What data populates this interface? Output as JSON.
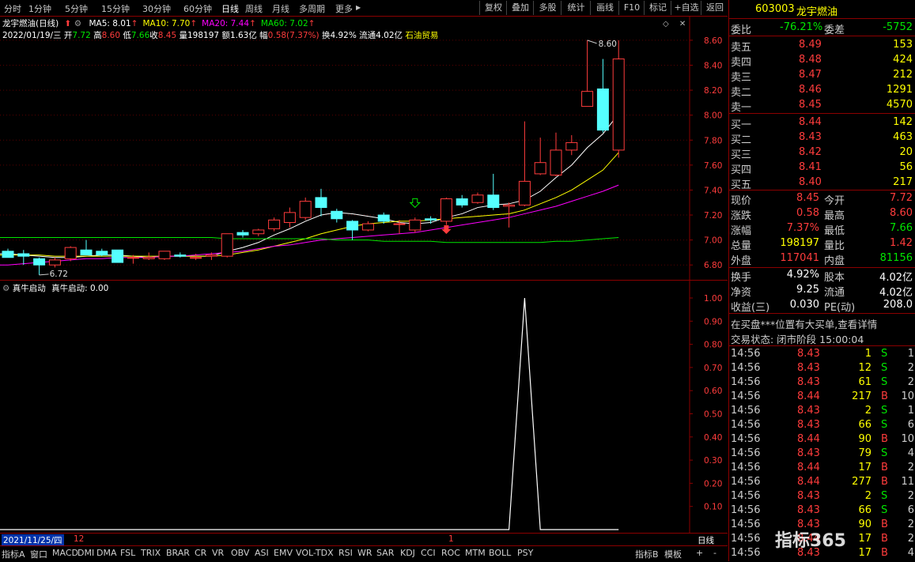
{
  "toolbar": {
    "timeframes": [
      "分时",
      "1分钟",
      "5分钟",
      "15分钟",
      "30分钟",
      "60分钟",
      "日线",
      "周线",
      "月线",
      "多周期",
      "更多"
    ],
    "active_timeframe": "日线",
    "more_arrow": "▶",
    "buttons": [
      "复权",
      "叠加",
      "多股",
      "统计",
      "画线",
      "F10",
      "标记",
      "+自选",
      "返回"
    ]
  },
  "main_chart": {
    "title": "龙宇燃油(日线)",
    "ma_labels": [
      {
        "text": "MA5: 8.01",
        "color": "#ffffff"
      },
      {
        "text": "MA10: 7.70",
        "color": "#ffff00"
      },
      {
        "text": "MA20: 7.44",
        "color": "#ff00ff"
      },
      {
        "text": "MA60: 7.02",
        "color": "#00e600"
      }
    ],
    "info": {
      "date": "2022/01/19/三",
      "open_label": "开",
      "open": "7.72",
      "high_label": "高",
      "high": "8.60",
      "low_label": "低",
      "low": "7.66",
      "close_label": "收",
      "close": "8.45",
      "vol_label": "量",
      "vol": "198197",
      "amt_label": "额",
      "amt": "1.63亿",
      "amp_label": "幅",
      "amp": "0.58(7.37%)",
      "turn_label": "换",
      "turn": "4.92%",
      "float_label": "流通",
      "float": "4.02亿",
      "concept": "石油贸易"
    },
    "y_ticks": [
      "8.60",
      "8.40",
      "8.20",
      "8.00",
      "7.80",
      "7.60",
      "7.40",
      "7.20",
      "7.00",
      "6.80"
    ],
    "max_label": "8.60",
    "min_label": "6.72"
  },
  "chart_data": [
    {
      "type": "candlestick",
      "title": "龙宇燃油(日线)",
      "ylim": [
        6.72,
        8.7
      ],
      "candles": [
        {
          "o": 6.91,
          "h": 6.93,
          "l": 6.86,
          "c": 6.86
        },
        {
          "o": 6.89,
          "h": 6.92,
          "l": 6.8,
          "c": 6.87
        },
        {
          "o": 6.85,
          "h": 6.86,
          "l": 6.72,
          "c": 6.8
        },
        {
          "o": 6.8,
          "h": 6.86,
          "l": 6.78,
          "c": 6.84
        },
        {
          "o": 6.85,
          "h": 6.95,
          "l": 6.83,
          "c": 6.94
        },
        {
          "o": 6.92,
          "h": 7.0,
          "l": 6.88,
          "c": 6.88
        },
        {
          "o": 6.91,
          "h": 6.93,
          "l": 6.87,
          "c": 6.88
        },
        {
          "o": 6.92,
          "h": 6.92,
          "l": 6.82,
          "c": 6.82
        },
        {
          "o": 6.86,
          "h": 6.88,
          "l": 6.81,
          "c": 6.86
        },
        {
          "o": 6.85,
          "h": 6.9,
          "l": 6.84,
          "c": 6.86
        },
        {
          "o": 6.85,
          "h": 6.91,
          "l": 6.84,
          "c": 6.91
        },
        {
          "o": 6.88,
          "h": 6.9,
          "l": 6.86,
          "c": 6.87
        },
        {
          "o": 6.86,
          "h": 6.89,
          "l": 6.84,
          "c": 6.86
        },
        {
          "o": 6.87,
          "h": 6.9,
          "l": 6.84,
          "c": 6.88
        },
        {
          "o": 6.87,
          "h": 7.05,
          "l": 6.86,
          "c": 7.05
        },
        {
          "o": 7.06,
          "h": 7.08,
          "l": 7.02,
          "c": 7.04
        },
        {
          "o": 7.05,
          "h": 7.09,
          "l": 7.03,
          "c": 7.08
        },
        {
          "o": 7.09,
          "h": 7.18,
          "l": 7.07,
          "c": 7.16
        },
        {
          "o": 7.14,
          "h": 7.26,
          "l": 7.1,
          "c": 7.22
        },
        {
          "o": 7.18,
          "h": 7.34,
          "l": 7.16,
          "c": 7.31
        },
        {
          "o": 7.34,
          "h": 7.41,
          "l": 7.19,
          "c": 7.26
        },
        {
          "o": 7.23,
          "h": 7.25,
          "l": 7.14,
          "c": 7.17
        },
        {
          "o": 7.15,
          "h": 7.16,
          "l": 7.0,
          "c": 7.08
        },
        {
          "o": 7.08,
          "h": 7.15,
          "l": 7.07,
          "c": 7.13
        },
        {
          "o": 7.2,
          "h": 7.22,
          "l": 7.13,
          "c": 7.15
        },
        {
          "o": 7.13,
          "h": 7.16,
          "l": 7.05,
          "c": 7.13
        },
        {
          "o": 7.08,
          "h": 7.18,
          "l": 7.06,
          "c": 7.16
        },
        {
          "o": 7.17,
          "h": 7.19,
          "l": 7.13,
          "c": 7.16
        },
        {
          "o": 7.15,
          "h": 7.34,
          "l": 7.12,
          "c": 7.33
        },
        {
          "o": 7.33,
          "h": 7.36,
          "l": 7.26,
          "c": 7.28
        },
        {
          "o": 7.3,
          "h": 7.38,
          "l": 7.29,
          "c": 7.36
        },
        {
          "o": 7.36,
          "h": 7.53,
          "l": 7.24,
          "c": 7.26
        },
        {
          "o": 7.27,
          "h": 7.3,
          "l": 7.1,
          "c": 7.28
        },
        {
          "o": 7.28,
          "h": 7.95,
          "l": 7.27,
          "c": 7.47
        },
        {
          "o": 7.53,
          "h": 7.82,
          "l": 7.52,
          "c": 7.62
        },
        {
          "o": 7.52,
          "h": 7.86,
          "l": 7.51,
          "c": 7.72
        },
        {
          "o": 7.72,
          "h": 7.84,
          "l": 7.68,
          "c": 7.78
        },
        {
          "o": 8.07,
          "h": 8.6,
          "l": 8.07,
          "c": 8.19
        },
        {
          "o": 8.21,
          "h": 8.45,
          "l": 7.86,
          "c": 7.88
        },
        {
          "o": 7.72,
          "h": 8.6,
          "l": 7.66,
          "c": 8.45
        }
      ],
      "series": [
        {
          "name": "MA5",
          "color": "#ffffff",
          "values": [
            6.89,
            6.88,
            6.87,
            6.86,
            6.86,
            6.87,
            6.88,
            6.88,
            6.87,
            6.86,
            6.87,
            6.87,
            6.87,
            6.87,
            6.91,
            6.94,
            6.98,
            7.04,
            7.09,
            7.15,
            7.2,
            7.22,
            7.21,
            7.19,
            7.17,
            7.14,
            7.13,
            7.14,
            7.18,
            7.21,
            7.26,
            7.28,
            7.29,
            7.32,
            7.39,
            7.5,
            7.6,
            7.74,
            7.85,
            8.01
          ]
        },
        {
          "name": "MA10",
          "color": "#ffff00",
          "values": [
            6.88,
            6.88,
            6.88,
            6.87,
            6.87,
            6.87,
            6.87,
            6.87,
            6.87,
            6.87,
            6.87,
            6.87,
            6.87,
            6.87,
            6.88,
            6.9,
            6.92,
            6.95,
            6.98,
            7.01,
            7.05,
            7.08,
            7.11,
            7.13,
            7.14,
            7.15,
            7.15,
            7.16,
            7.17,
            7.18,
            7.19,
            7.2,
            7.21,
            7.24,
            7.29,
            7.34,
            7.4,
            7.48,
            7.56,
            7.7
          ]
        },
        {
          "name": "MA20",
          "color": "#ff00ff",
          "values": [
            6.8,
            6.81,
            6.82,
            6.83,
            6.84,
            6.85,
            6.85,
            6.86,
            6.86,
            6.86,
            6.87,
            6.87,
            6.88,
            6.89,
            6.9,
            6.91,
            6.93,
            6.95,
            6.96,
            6.98,
            7.0,
            7.01,
            7.02,
            7.03,
            7.04,
            7.05,
            7.06,
            7.08,
            7.1,
            7.12,
            7.14,
            7.16,
            7.18,
            7.21,
            7.24,
            7.27,
            7.31,
            7.35,
            7.39,
            7.44
          ]
        },
        {
          "name": "MA60",
          "color": "#00e600",
          "values": [
            7.02,
            7.02,
            7.02,
            7.02,
            7.02,
            7.02,
            7.02,
            7.02,
            7.02,
            7.02,
            7.02,
            7.02,
            7.02,
            7.02,
            7.01,
            7.01,
            7.01,
            7.01,
            7.01,
            7.01,
            7.01,
            7.0,
            7.0,
            7.0,
            6.99,
            6.99,
            6.99,
            6.99,
            6.98,
            6.98,
            6.98,
            6.98,
            6.98,
            6.98,
            6.98,
            6.99,
            6.99,
            7.0,
            7.01,
            7.02
          ]
        }
      ]
    },
    {
      "type": "line",
      "title": "真牛启动",
      "ylim": [
        0,
        1.05
      ],
      "series": [
        {
          "name": "真牛启动",
          "values": [
            0,
            0,
            0,
            0,
            0,
            0,
            0,
            0,
            0,
            0,
            0,
            0,
            0,
            0,
            0,
            0,
            0,
            0,
            0,
            0,
            0,
            0,
            0,
            0,
            0,
            0,
            0,
            0,
            0,
            0,
            0,
            0,
            0,
            1,
            0,
            0,
            0,
            0,
            0,
            0
          ]
        }
      ]
    }
  ],
  "indicator_chart": {
    "name": "真牛启动",
    "value_label": "真牛启动: 0.00",
    "y_ticks": [
      "1.00",
      "0.90",
      "0.80",
      "0.70",
      "0.60",
      "0.50",
      "0.40",
      "0.30",
      "0.20",
      "0.10"
    ]
  },
  "x_axis": {
    "start_date": "2021/11/25/四",
    "tick1": "12",
    "tick2": "1",
    "period": "日线"
  },
  "bottom_tabs": [
    "指标A",
    "窗口",
    "MACD",
    "DMI",
    "DMA",
    "FSL",
    "TRIX",
    "BRAR",
    "CR",
    "VR",
    "OBV",
    "ASI",
    "EMV",
    "VOL-TDX",
    "RSI",
    "WR",
    "SAR",
    "KDJ",
    "CCI",
    "ROC",
    "MTM",
    "BOLL",
    "PSY"
  ],
  "bottom_right_tabs": [
    "指标B",
    "模板",
    "+",
    "-"
  ],
  "quote": {
    "code": "603003",
    "name": "龙宇燃油",
    "weibi_label": "委比",
    "weibi": "-76.21%",
    "weicha_label": "委差",
    "weicha": "-5752",
    "asks": [
      {
        "label": "卖五",
        "price": "8.49",
        "vol": "153"
      },
      {
        "label": "卖四",
        "price": "8.48",
        "vol": "424"
      },
      {
        "label": "卖三",
        "price": "8.47",
        "vol": "212"
      },
      {
        "label": "卖二",
        "price": "8.46",
        "vol": "1291"
      },
      {
        "label": "卖一",
        "price": "8.45",
        "vol": "4570"
      }
    ],
    "bids": [
      {
        "label": "买一",
        "price": "8.44",
        "vol": "142"
      },
      {
        "label": "买二",
        "price": "8.43",
        "vol": "463"
      },
      {
        "label": "买三",
        "price": "8.42",
        "vol": "20"
      },
      {
        "label": "买四",
        "price": "8.41",
        "vol": "56"
      },
      {
        "label": "买五",
        "price": "8.40",
        "vol": "217"
      }
    ],
    "stats": [
      {
        "l1": "现价",
        "v1": "8.45",
        "c1": "#ff3c3c",
        "l2": "今开",
        "v2": "7.72",
        "c2": "#ff3c3c"
      },
      {
        "l1": "涨跌",
        "v1": "0.58",
        "c1": "#ff3c3c",
        "l2": "最高",
        "v2": "8.60",
        "c2": "#ff3c3c"
      },
      {
        "l1": "涨幅",
        "v1": "7.37%",
        "c1": "#ff3c3c",
        "l2": "最低",
        "v2": "7.66",
        "c2": "#00e600"
      },
      {
        "l1": "总量",
        "v1": "198197",
        "c1": "#ffff00",
        "l2": "量比",
        "v2": "1.42",
        "c2": "#ff3c3c"
      },
      {
        "l1": "外盘",
        "v1": "117041",
        "c1": "#ff3c3c",
        "l2": "内盘",
        "v2": "81156",
        "c2": "#00e600"
      }
    ],
    "stats2": [
      {
        "l1": "换手",
        "v1": "4.92%",
        "l2": "股本",
        "v2": "4.02亿"
      },
      {
        "l1": "净资",
        "v1": "9.25",
        "l2": "流通",
        "v2": "4.02亿"
      },
      {
        "l1": "收益(三)",
        "v1": "0.030",
        "l2": "PE(动)",
        "v2": "208.0"
      }
    ],
    "notice": "在买盘***位置有大买单,查看详情",
    "status": "交易状态: 闭市阶段 15:00:04",
    "trades": [
      {
        "t": "14:56",
        "p": "8.43",
        "v": "1",
        "d": "S",
        "n": "1"
      },
      {
        "t": "14:56",
        "p": "8.43",
        "v": "12",
        "d": "S",
        "n": "2"
      },
      {
        "t": "14:56",
        "p": "8.43",
        "v": "61",
        "d": "S",
        "n": "2"
      },
      {
        "t": "14:56",
        "p": "8.44",
        "v": "217",
        "d": "B",
        "n": "10"
      },
      {
        "t": "14:56",
        "p": "8.43",
        "v": "2",
        "d": "S",
        "n": "1"
      },
      {
        "t": "14:56",
        "p": "8.43",
        "v": "66",
        "d": "S",
        "n": "6"
      },
      {
        "t": "14:56",
        "p": "8.44",
        "v": "90",
        "d": "B",
        "n": "10"
      },
      {
        "t": "14:56",
        "p": "8.43",
        "v": "79",
        "d": "S",
        "n": "4"
      },
      {
        "t": "14:56",
        "p": "8.44",
        "v": "17",
        "d": "B",
        "n": "2"
      },
      {
        "t": "14:56",
        "p": "8.44",
        "v": "277",
        "d": "B",
        "n": "11"
      },
      {
        "t": "14:56",
        "p": "8.43",
        "v": "2",
        "d": "S",
        "n": "2"
      },
      {
        "t": "14:56",
        "p": "8.43",
        "v": "66",
        "d": "S",
        "n": "6"
      },
      {
        "t": "14:56",
        "p": "8.43",
        "v": "90",
        "d": "B",
        "n": "2"
      },
      {
        "t": "14:56",
        "p": "8.44",
        "v": "17",
        "d": "B",
        "n": "2"
      },
      {
        "t": "14:56",
        "p": "8.43",
        "v": "17",
        "d": "B",
        "n": "4"
      }
    ],
    "watermark": "指标365"
  },
  "colors": {
    "up": "#ff3c3c",
    "down": "#55ffff",
    "border": "#8b0000",
    "grid": "#5a0000"
  }
}
